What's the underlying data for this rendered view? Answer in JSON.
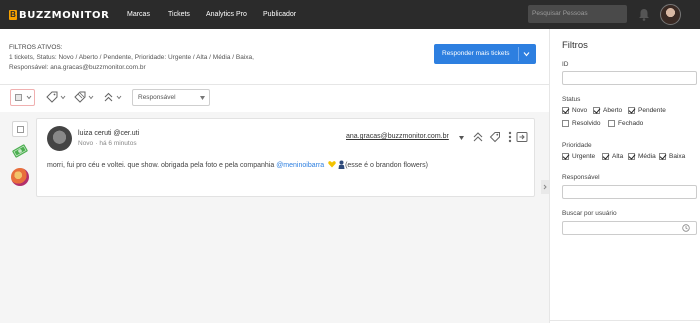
{
  "nav": {
    "logo": "BUZZMONITOR",
    "items": [
      "Marcas",
      "Tickets",
      "Analytics Pro",
      "Publicador"
    ],
    "search_placeholder": "Pesquisar Pessoas"
  },
  "filters": {
    "title": "FILTROS ATIVOS:",
    "line1": "1 tickets, Status: Novo / Aberto / Pendente, Prioridade: Urgente / Alta / Média / Baixa,",
    "line2": "Responsável: ana.gracas@buzzmonitor.com.br"
  },
  "respond_button": "Responder mais tickets",
  "toolbar": {
    "responsavel": "Responsável"
  },
  "ticket": {
    "author": "luiza ceruti @cer.uti",
    "status": "Novo",
    "time": "há 6 minutos",
    "assignee": "ana.gracas@buzzmonitor.com.br",
    "message_before": "morri, fui pro céu e voltei. que show. obrigada pela foto e pela companhia ",
    "mention": "@meninoibarra",
    "message_after": "(esse é o brandon flowers)"
  },
  "panel": {
    "title": "Filtros",
    "id_label": "ID",
    "status_label": "Status",
    "status_options": [
      {
        "label": "Novo",
        "checked": true
      },
      {
        "label": "Aberto",
        "checked": true
      },
      {
        "label": "Pendente",
        "checked": true
      },
      {
        "label": "Resolvido",
        "checked": false
      },
      {
        "label": "Fechado",
        "checked": false
      }
    ],
    "priority_label": "Prioridade",
    "priority_options": [
      {
        "label": "Urgente",
        "checked": true
      },
      {
        "label": "Alta",
        "checked": true
      },
      {
        "label": "Média",
        "checked": true
      },
      {
        "label": "Baixa",
        "checked": true
      }
    ],
    "responsavel_label": "Responsável",
    "user_label": "Buscar por usuário"
  },
  "colors": {
    "nav_bg": "#2b2b2b",
    "primary": "#2d7fe0",
    "logo": "#f6a100"
  }
}
